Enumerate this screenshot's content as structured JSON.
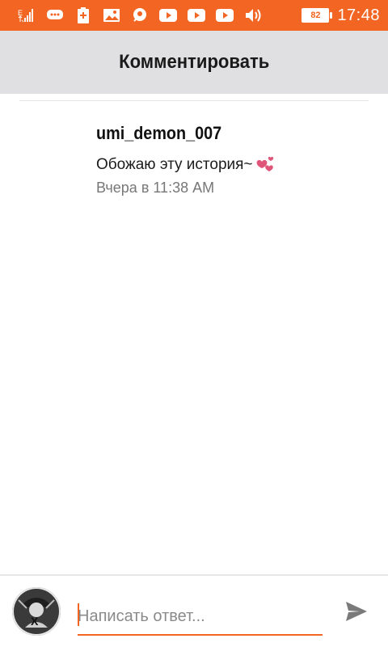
{
  "status_bar": {
    "battery": "82",
    "time": "17:48",
    "icons": [
      "signal-icon",
      "chat-icon",
      "battery-plus-icon",
      "gallery-icon",
      "map-pin-icon",
      "youtube-icon",
      "youtube-icon",
      "youtube-icon",
      "volume-icon"
    ]
  },
  "header": {
    "title": "Комментировать"
  },
  "comment": {
    "username": "umi_demon_007",
    "text": "Обожаю эту история~",
    "emoji": "hearts-emoji",
    "timestamp": "Вчера в 11:38 AM"
  },
  "reply": {
    "placeholder": "Написать ответ...",
    "send_icon": "send-icon"
  },
  "colors": {
    "accent": "#f26522",
    "header_bg": "#e0e0e2",
    "hearts": "#e0557a"
  }
}
